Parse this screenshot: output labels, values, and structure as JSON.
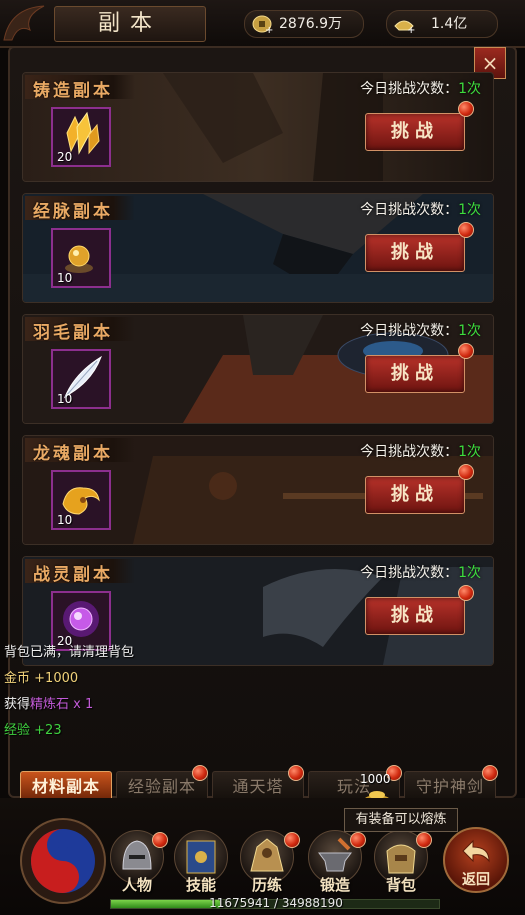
{
  "header": {
    "title": "副本",
    "gold": "2876.9万",
    "ingot": "1.4亿",
    "close_icon": "×"
  },
  "dungeons": [
    {
      "name": "铸造副本",
      "count_label": "今日挑战次数：",
      "count": "1次",
      "item_qty": "20",
      "button": "挑战",
      "item_icon": "gold-crystal-icon"
    },
    {
      "name": "经脉副本",
      "count_label": "今日挑战次数：",
      "count": "1次",
      "item_qty": "10",
      "button": "挑战",
      "item_icon": "golden-orb-icon"
    },
    {
      "name": "羽毛副本",
      "count_label": "今日挑战次数：",
      "count": "1次",
      "item_qty": "10",
      "button": "挑战",
      "item_icon": "feather-icon"
    },
    {
      "name": "龙魂副本",
      "count_label": "今日挑战次数：",
      "count": "1次",
      "item_qty": "10",
      "button": "挑战",
      "item_icon": "dragon-soul-icon"
    },
    {
      "name": "战灵副本",
      "count_label": "今日挑战次数：",
      "count": "1次",
      "item_qty": "20",
      "button": "挑战",
      "item_icon": "purple-orb-icon"
    }
  ],
  "log": {
    "bag_full": "背包已满，请清理背包",
    "gold_label": "金币",
    "gold_amount": "+1000",
    "obtain_label": "获得",
    "obtain_item": "精炼石 x 1",
    "exp_label": "经验",
    "exp_amount": "+23"
  },
  "tabs": [
    "材料副本",
    "经验副本",
    "通天塔",
    "玩法",
    "守护神剑"
  ],
  "floating_reward": "1000",
  "tooltip": "有装备可以熔炼",
  "nav": [
    "人物",
    "技能",
    "历练",
    "锻造",
    "背包"
  ],
  "back_label": "返回",
  "exp_text": "11675941 / 34988190",
  "exp_progress": 0.3337,
  "colors": {
    "accent": "#e9a964",
    "count_green": "#3ddc3d",
    "log_purple": "#c35bd8",
    "log_green": "#3fd13f",
    "log_gold": "#f1d27a"
  }
}
